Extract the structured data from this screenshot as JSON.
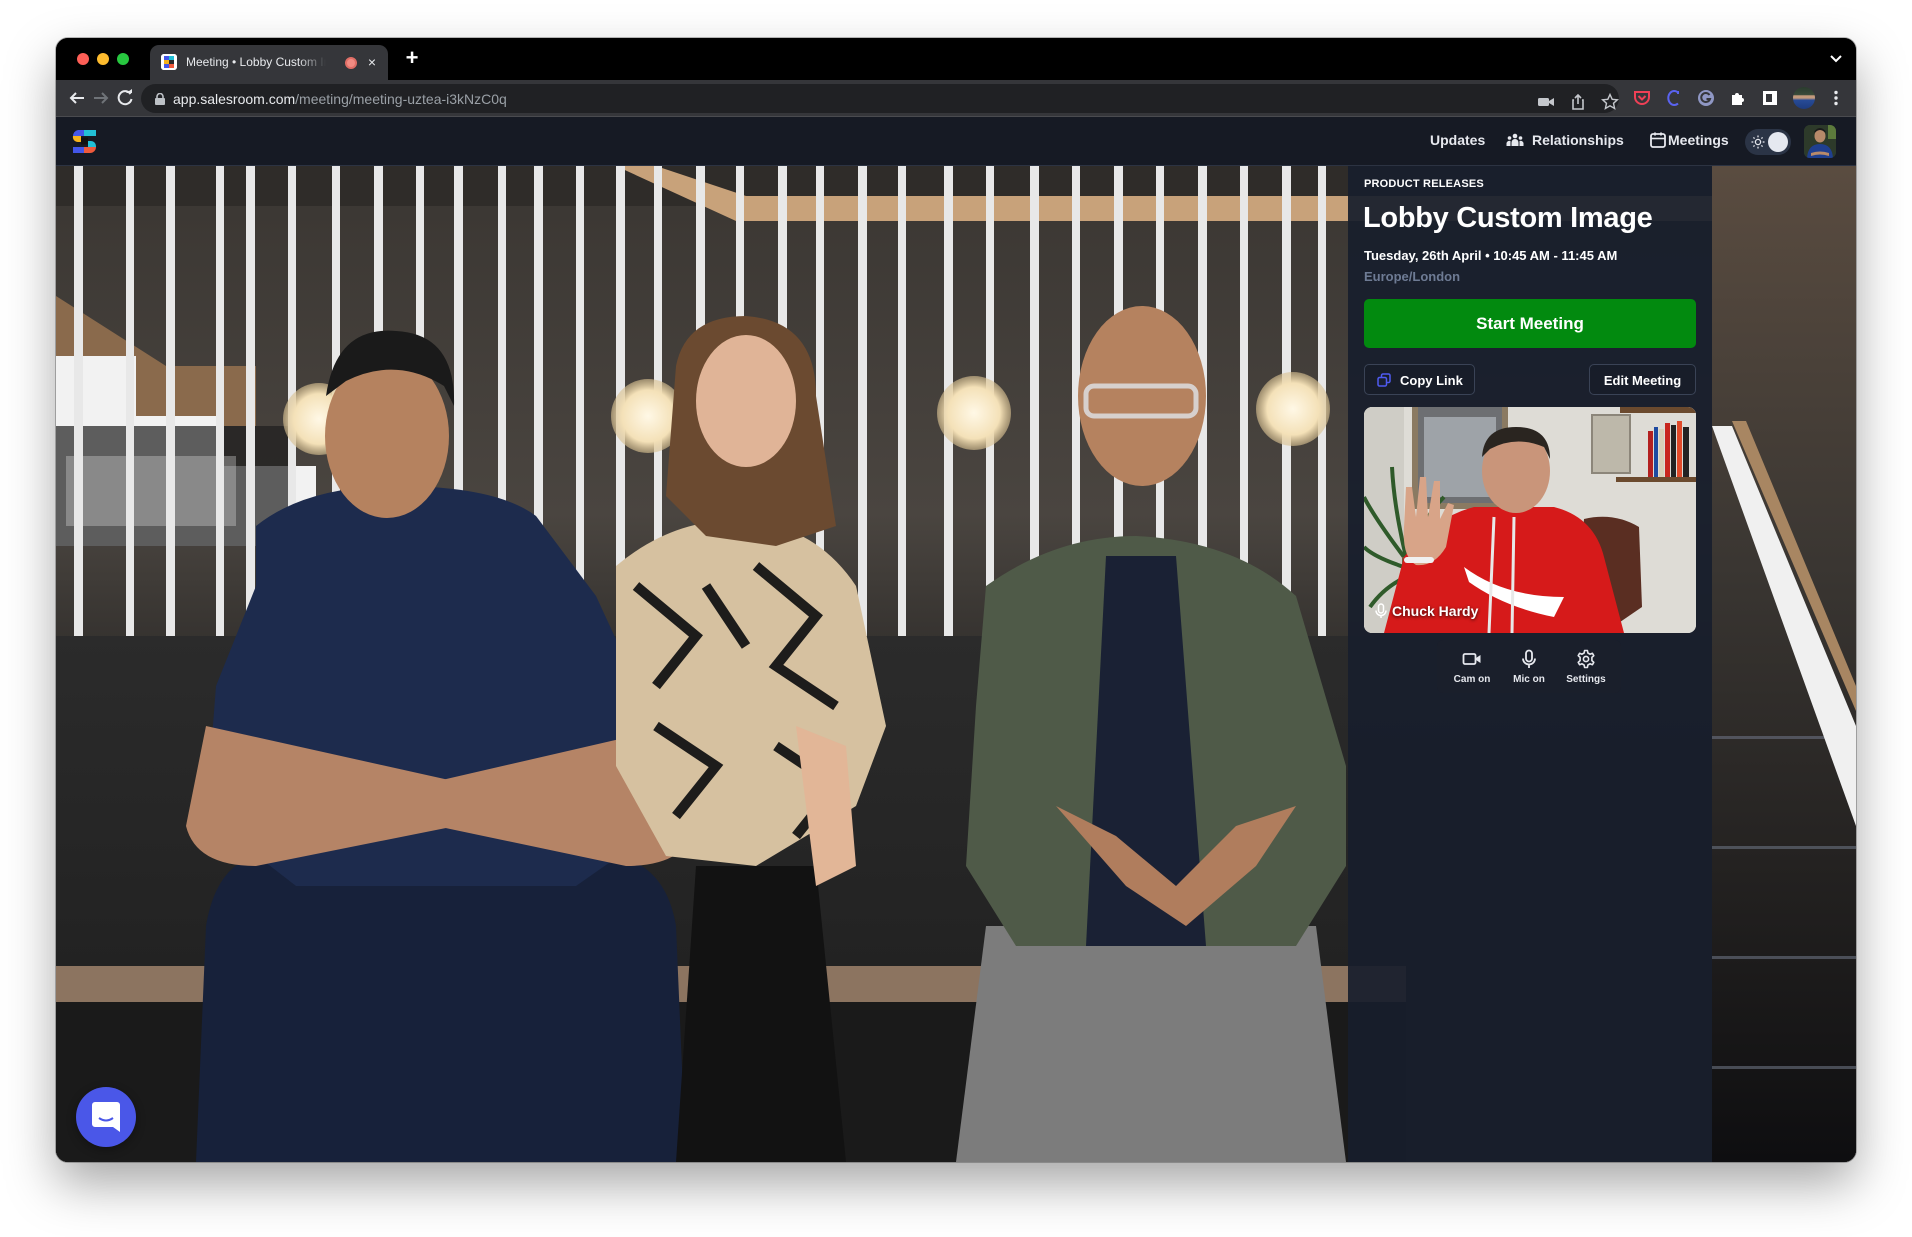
{
  "browser": {
    "tab": {
      "title": "Meeting • Lobby Custom Image",
      "recording_indicator": "recording-dot",
      "close_label": "×"
    },
    "new_tab_label": "+",
    "url": {
      "host": "app.salesroom.com",
      "path": "/meeting/meeting-uztea-i3kNzC0q"
    },
    "toolbar_icons": [
      "camera-icon",
      "share-icon",
      "bookmark-star-icon",
      "pocket-icon",
      "c-extension-icon",
      "g-extension-icon",
      "extensions-puzzle-icon",
      "sidebar-icon",
      "profile-avatar",
      "kebab-menu-icon"
    ]
  },
  "appnav": {
    "brand": "Salesroom",
    "links": {
      "updates": "Updates",
      "relationships": "Relationships",
      "meetings": "Meetings"
    },
    "theme": "light"
  },
  "panel": {
    "eyebrow": "PRODUCT RELEASES",
    "title": "Lobby Custom Image",
    "when": "Tuesday, 26th April • 10:45 AM - 11:45 AM",
    "timezone": "Europe/London",
    "start_button": "Start Meeting",
    "copy_link": "Copy Link",
    "edit_meeting": "Edit Meeting",
    "participant_name": "Chuck Hardy",
    "controls": {
      "cam": "Cam on",
      "mic": "Mic on",
      "settings": "Settings"
    }
  },
  "colors": {
    "start_green": "#028a0f",
    "panel_bg": "#181e2c",
    "chat_launcher": "#4a57e8",
    "copy_icon_blue": "#4f5bf0"
  }
}
